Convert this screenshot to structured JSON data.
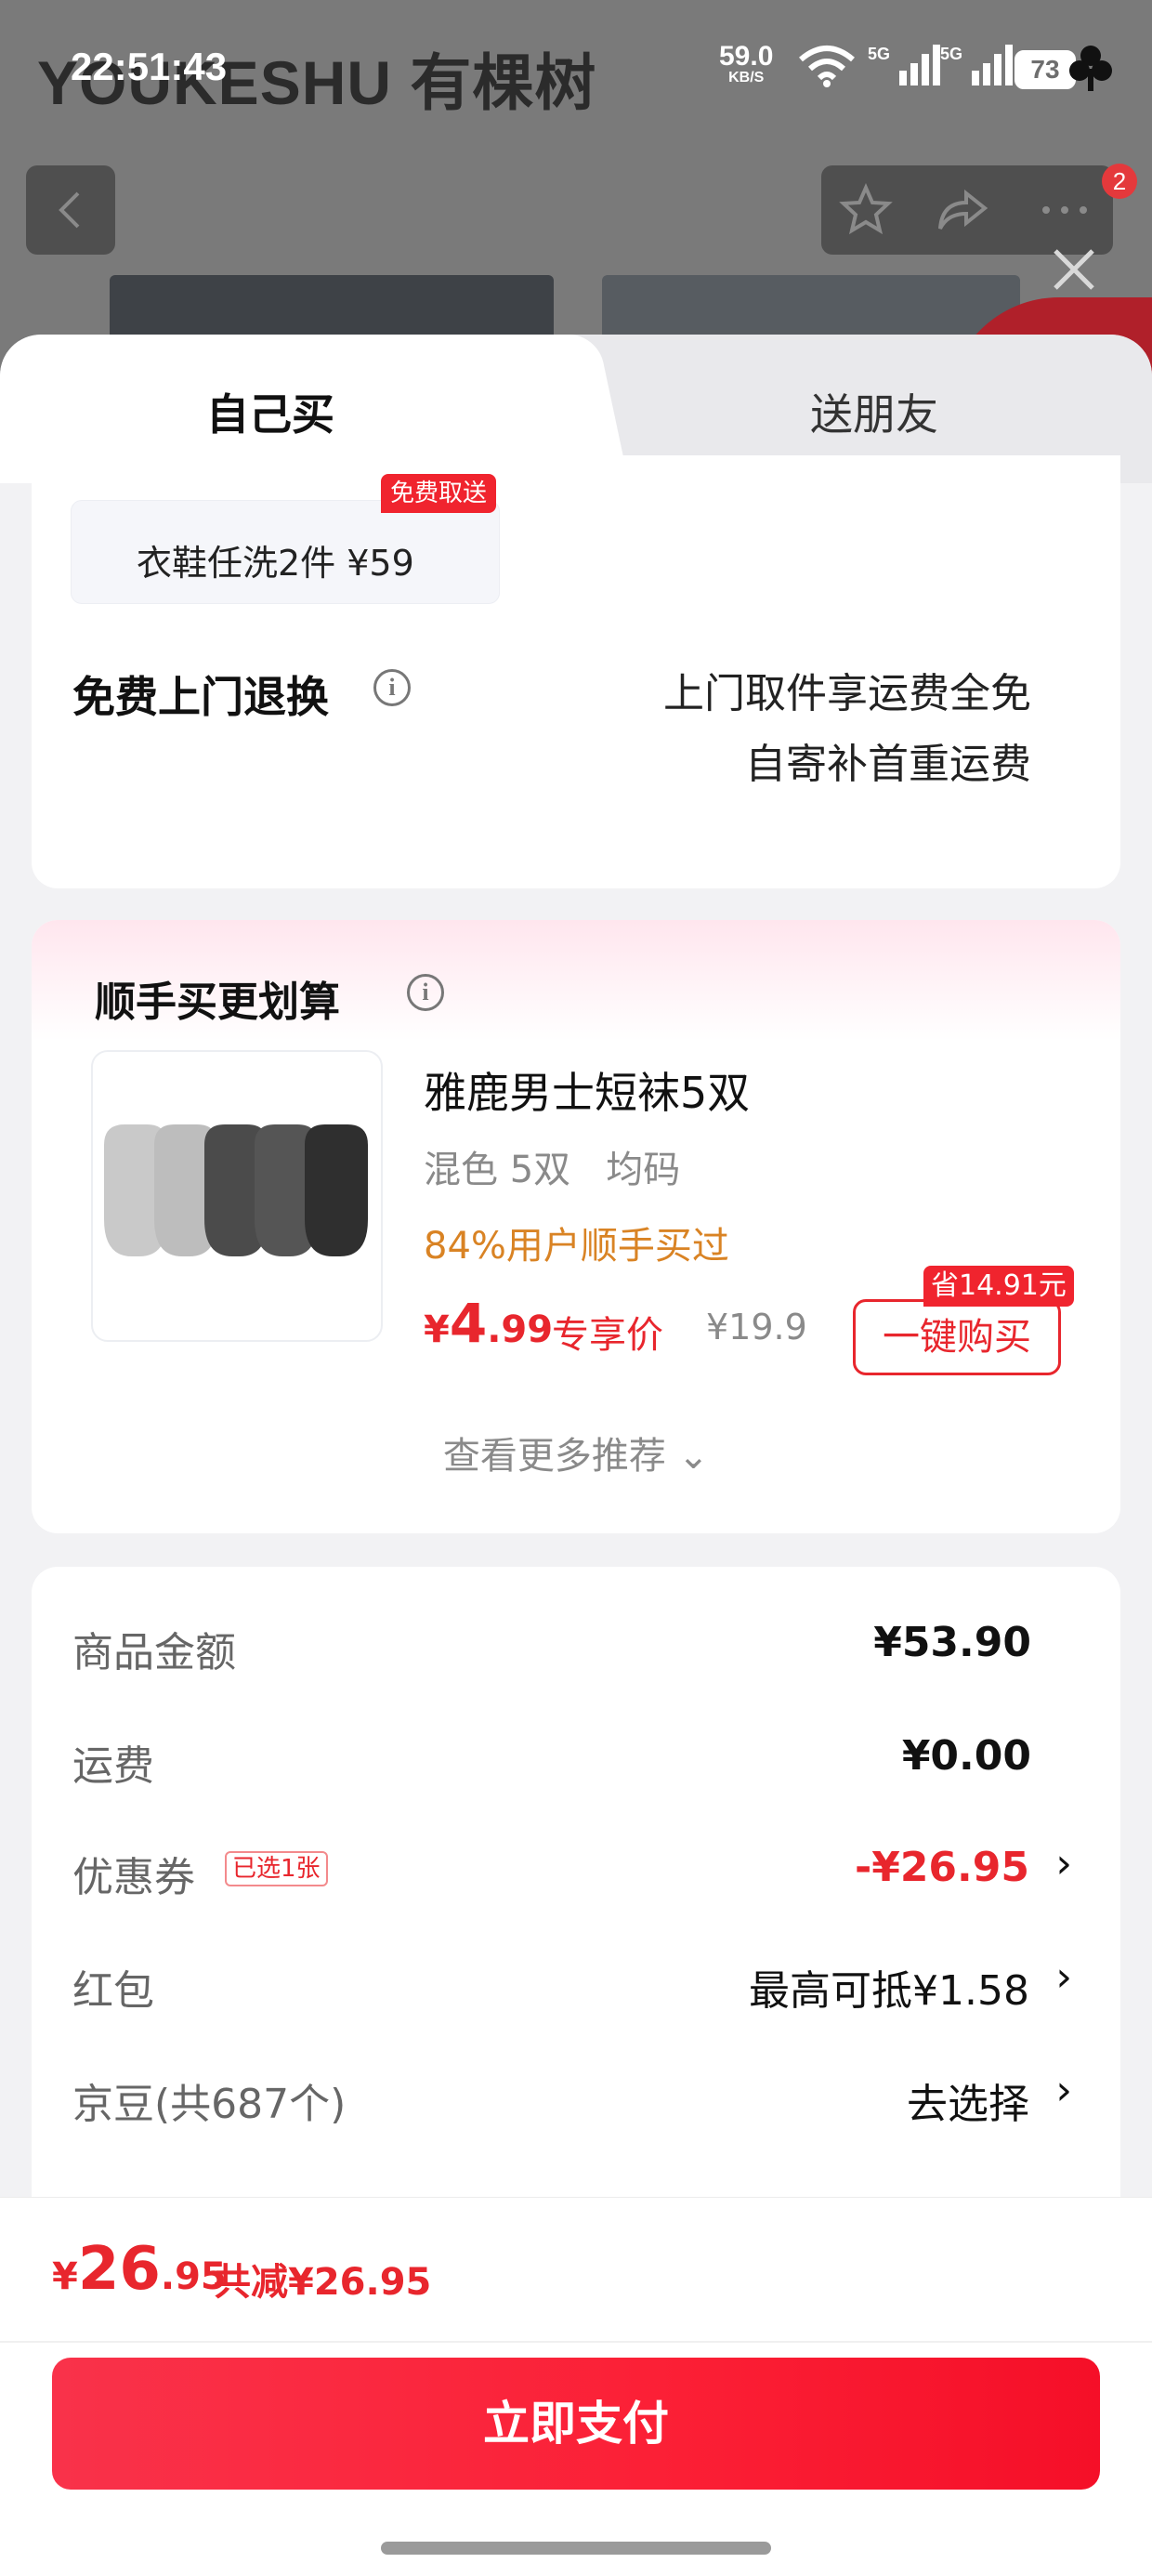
{
  "status_bar": {
    "time": "22:51:43",
    "net_speed": "59.0",
    "net_speed_unit": "KB/S",
    "network_1": "5G",
    "network_2": "5G",
    "battery": "73"
  },
  "background": {
    "brand": "YOUKESHU 有棵树",
    "notification_count": "2"
  },
  "tabs": {
    "self": "自己买",
    "gift": "送朋友"
  },
  "service": {
    "wash_option": "衣鞋任洗2件  ¥59",
    "wash_tag": "免费取送",
    "return_title": "免费上门退换",
    "return_line1": "上门取件享运费全免",
    "return_line2": "自寄补首重运费"
  },
  "addon": {
    "title": "顺手买更划算",
    "product_name": "雅鹿男士短袜5双",
    "spec": "混色 5双   均码",
    "bought_rate": "84%用户顺手买过",
    "price_currency": "¥",
    "price_int": "4",
    "price_dec": ".99",
    "price_label": "专享价",
    "original_price": "¥19.9",
    "buy_button": "一键购买",
    "save_tag": "省14.91元",
    "more": "查看更多推荐 ⌄"
  },
  "summary": {
    "rows": [
      {
        "label": "商品金额",
        "value": "¥53.90"
      },
      {
        "label": "运费",
        "value": "¥0.00"
      },
      {
        "label": "优惠券",
        "chip": "已选1张",
        "value": "-¥26.95",
        "chevron": "›"
      },
      {
        "label": "红包",
        "value": "最高可抵¥1.58",
        "chevron": "›"
      },
      {
        "label": "京豆(共687个)",
        "value": "去选择",
        "chevron": "›"
      }
    ]
  },
  "footer": {
    "total_currency": "¥",
    "total_int": "26",
    "total_dec": ".95",
    "total_saved": "共减¥26.95",
    "pay_button": "立即支付"
  },
  "colors": {
    "accent_red": "#e8262d",
    "pay_button": "#fb1f35",
    "bought_orange": "#d98324"
  }
}
